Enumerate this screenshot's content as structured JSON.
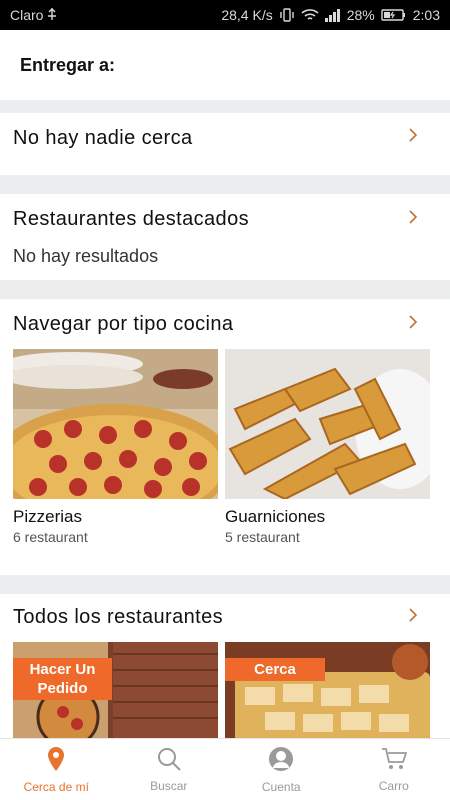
{
  "status_bar": {
    "carrier": "Claro",
    "speed": "28,4 K/s",
    "battery": "28%",
    "time": "2:03"
  },
  "deliver": {
    "label": "Entregar a:"
  },
  "sections": {
    "nearby": {
      "title": "No hay nadie cerca"
    },
    "featured": {
      "title": "Restaurantes destacados",
      "empty": "No hay resultados"
    },
    "cuisine": {
      "title": "Navegar por tipo cocina",
      "items": [
        {
          "name": "Pizzerias",
          "count": "6 restaurant"
        },
        {
          "name": "Guarniciones",
          "count": "5 restaurant"
        }
      ]
    },
    "all": {
      "title": "Todos los restaurantes",
      "items": [
        {
          "badge": "Hacer Un\nPedido"
        },
        {
          "badge": "Cerca"
        }
      ]
    }
  },
  "nav": {
    "items": [
      {
        "label": "Cerca de mí",
        "icon": "location-pin-icon"
      },
      {
        "label": "Buscar",
        "icon": "search-icon"
      },
      {
        "label": "Cuenta",
        "icon": "account-icon"
      },
      {
        "label": "Carro",
        "icon": "cart-icon"
      }
    ]
  },
  "colors": {
    "accent": "#e8732d",
    "badge": "#ef6a2a",
    "divider": "#ebedef"
  }
}
